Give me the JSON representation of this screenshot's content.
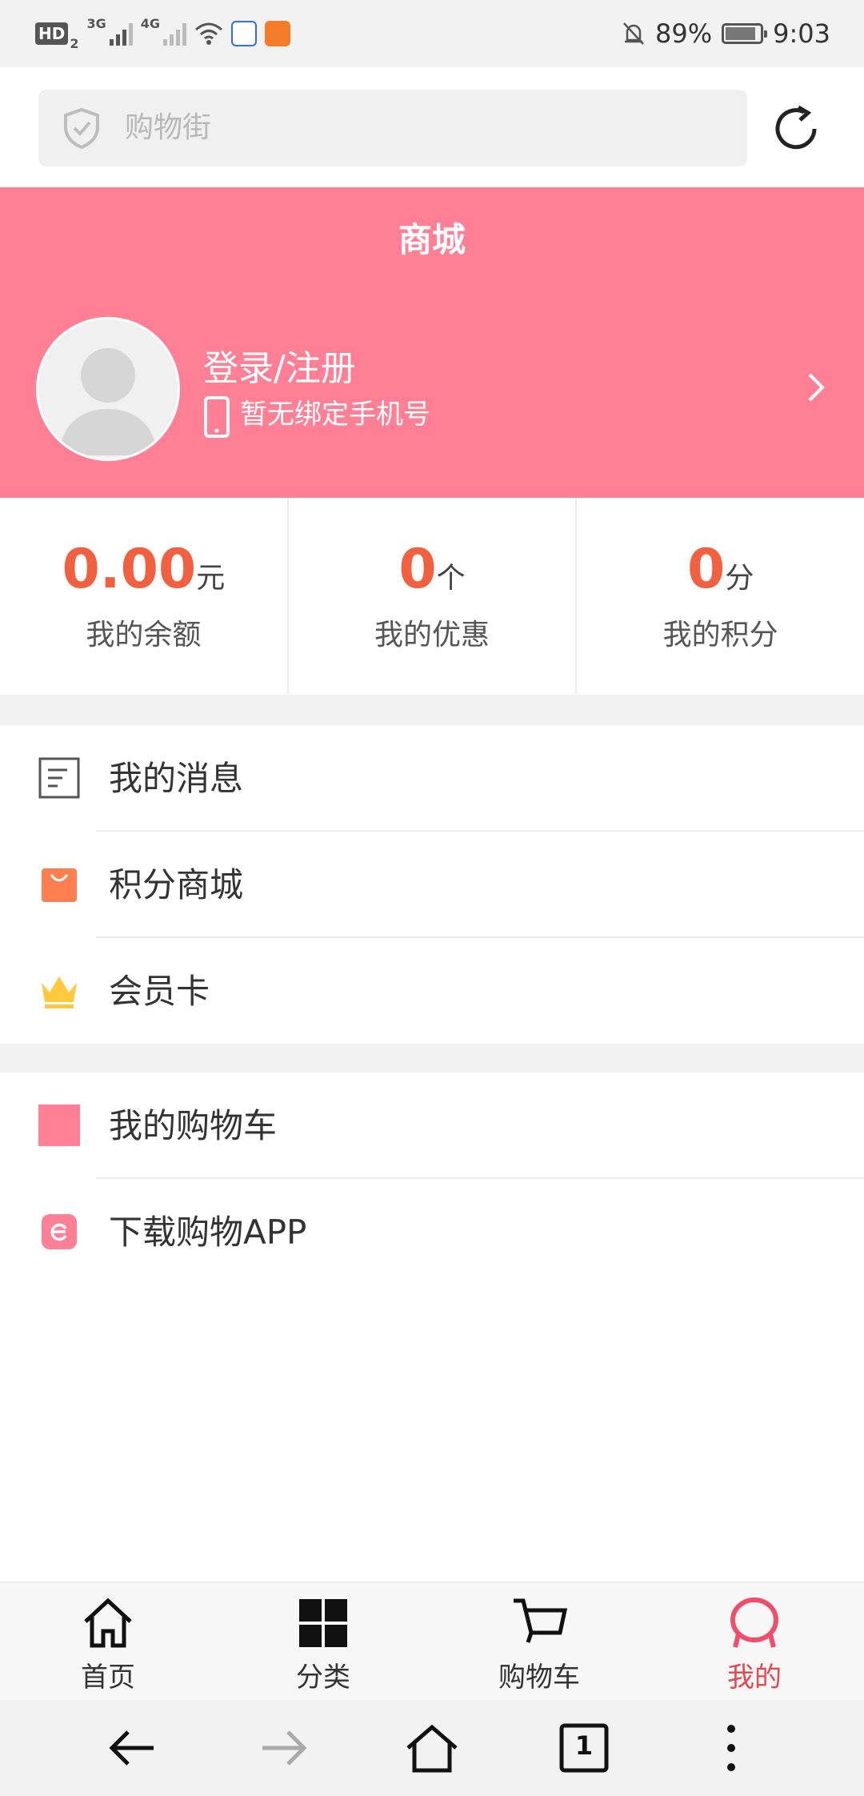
{
  "status_bar": {
    "hd_label": "HD",
    "hd_sub": "2",
    "sig1_label": "3G",
    "sig2_label": "4G",
    "battery_text": "89%",
    "battery_level": 0.89,
    "time": "9:03",
    "icons": [
      "signal-icon",
      "wifi-icon",
      "baidu-icon",
      "uc-browser-icon",
      "bell-off-icon",
      "battery-icon"
    ]
  },
  "search": {
    "placeholder": "购物街"
  },
  "banner": {
    "title": "商城",
    "login_label": "登录/注册",
    "phone_status": "暂无绑定手机号",
    "color": "#ff7f95"
  },
  "stats": [
    {
      "value": "0.00",
      "unit": "元",
      "label": "我的余额"
    },
    {
      "value": "0",
      "unit": "个",
      "label": "我的优惠"
    },
    {
      "value": "0",
      "unit": "分",
      "label": "我的积分"
    }
  ],
  "menu_group_1": [
    {
      "label": "我的消息",
      "icon": "message-icon"
    },
    {
      "label": "积分商城",
      "icon": "shopping-bag-icon"
    },
    {
      "label": "会员卡",
      "icon": "crown-icon"
    }
  ],
  "menu_group_2": [
    {
      "label": "我的购物车",
      "icon": "cart-square-icon"
    },
    {
      "label": "下载购物APP",
      "icon": "app-download-icon"
    }
  ],
  "bottom_nav": [
    {
      "label": "首页",
      "icon": "home-icon"
    },
    {
      "label": "分类",
      "icon": "grid-icon"
    },
    {
      "label": "购物车",
      "icon": "cart-icon"
    },
    {
      "label": "我的",
      "icon": "profile-icon",
      "active": true
    }
  ],
  "browser_bar": {
    "tab_count": "1",
    "icons": [
      "back-arrow-icon",
      "forward-arrow-icon",
      "browser-home-icon",
      "tabs-icon",
      "more-icon"
    ]
  },
  "colors": {
    "accent": "#f2603f",
    "active_nav": "#e5484d",
    "pink": "#ff7f95"
  }
}
